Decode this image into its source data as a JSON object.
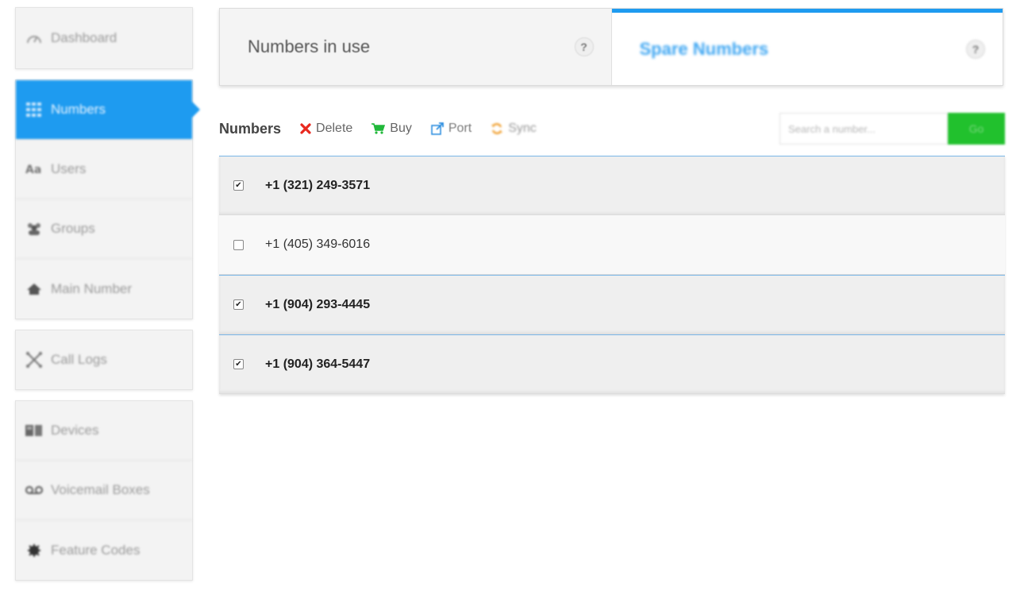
{
  "sidebar": {
    "dashboard": "Dashboard",
    "items": [
      {
        "label": "Numbers",
        "icon": "grid-icon",
        "active": true
      },
      {
        "label": "Users",
        "icon": "users-icon"
      },
      {
        "label": "Groups",
        "icon": "groups-icon"
      },
      {
        "label": "Main Number",
        "icon": "home-icon"
      }
    ],
    "call_logs": "Call Logs",
    "device_items": [
      {
        "label": "Devices",
        "icon": "devices-icon"
      },
      {
        "label": "Voicemail Boxes",
        "icon": "voicemail-icon"
      },
      {
        "label": "Feature Codes",
        "icon": "feature-codes-icon"
      }
    ]
  },
  "tabs": [
    {
      "label": "Numbers in use",
      "help": "?"
    },
    {
      "label": "Spare Numbers",
      "help": "?",
      "active": true
    }
  ],
  "toolbar": {
    "title": "Numbers",
    "delete": "Delete",
    "buy": "Buy",
    "port": "Port",
    "sync": "Sync",
    "search_placeholder": "Search a number...",
    "go": "Go"
  },
  "numbers": [
    {
      "number": "+1 (321) 249-3571",
      "checked": true
    },
    {
      "number": "+1 (405) 349-6016",
      "checked": false
    },
    {
      "number": "+1 (904) 293-4445",
      "checked": true
    },
    {
      "number": "+1 (904) 364-5447",
      "checked": true
    }
  ],
  "colors": {
    "accent": "#1e9bf0",
    "go_button": "#21c12d",
    "delete": "#e8281e",
    "buy": "#21b83a",
    "sync": "#f0a030"
  }
}
